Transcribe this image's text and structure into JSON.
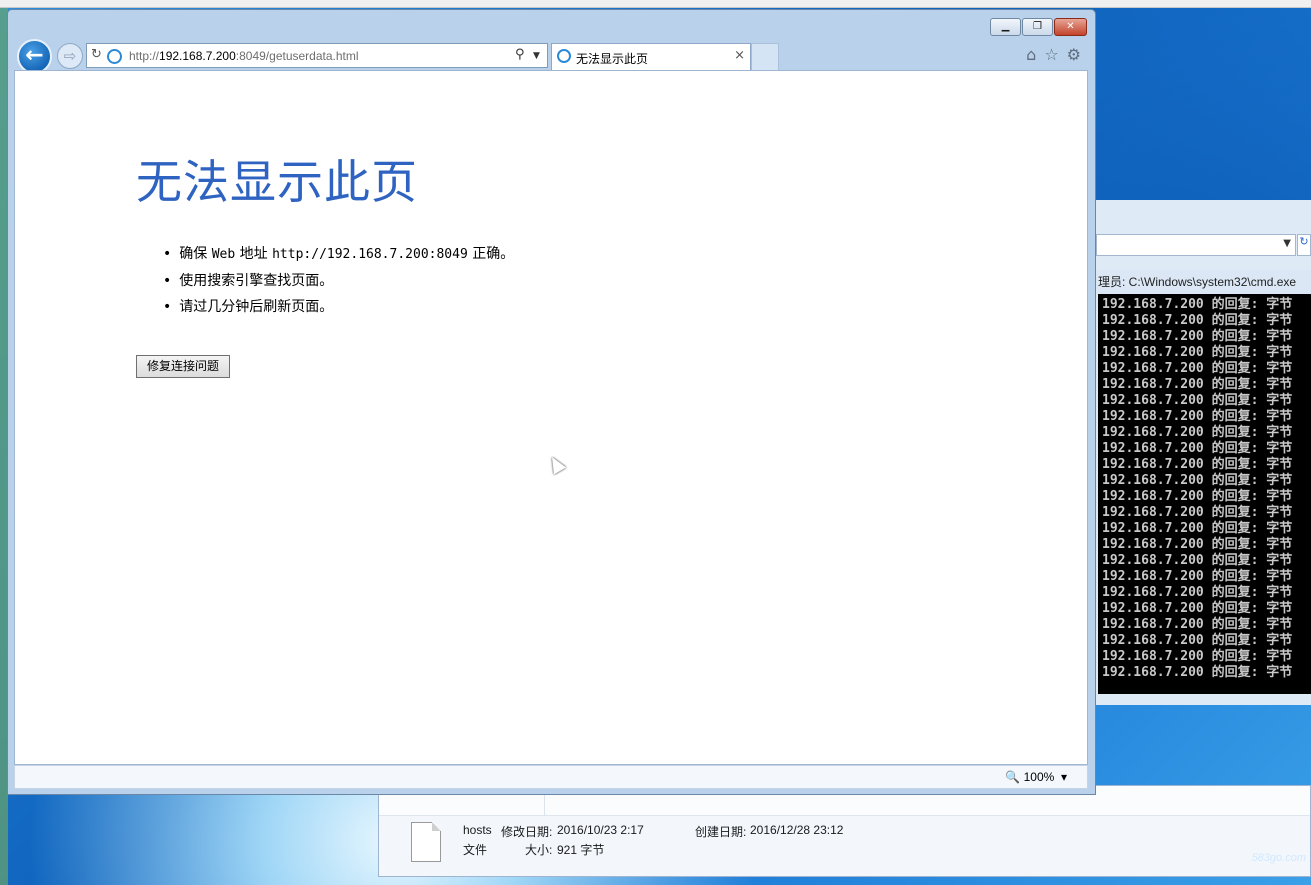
{
  "window": {
    "minimize_label": "▁",
    "maximize_label": "❐",
    "close_label": "✕"
  },
  "address_bar": {
    "url_prefix": "http://",
    "url_host": "192.168.7.200",
    "url_rest": ":8049/getuserdata.html"
  },
  "tab": {
    "title": "无法显示此页",
    "close_label": "×"
  },
  "page": {
    "title": "无法显示此页",
    "bullets": [
      {
        "pre": "确保 ",
        "mono": "Web",
        "mid": " 地址 ",
        "mono2": "http://192.168.7.200:8049",
        "post": " 正确。"
      },
      {
        "pre": "使用搜索引擎查找页面。"
      },
      {
        "pre": "请过几分钟后刷新页面。"
      }
    ],
    "fix_button": "修复连接问题"
  },
  "status_bar": {
    "zoom": "100%"
  },
  "cmd": {
    "title": "理员: C:\\Windows\\system32\\cmd.exe",
    "line": "192.168.7.200 的回复: 字节",
    "line_count": 24
  },
  "explorer": {
    "file_name": "hosts",
    "modified_label": "修改日期:",
    "modified_value": "2016/10/23 2:17",
    "created_label": "创建日期:",
    "created_value": "2016/12/28 23:12",
    "type_value": "文件",
    "size_label": "大小:",
    "size_value": "921 字节"
  },
  "watermark": "583go.com"
}
